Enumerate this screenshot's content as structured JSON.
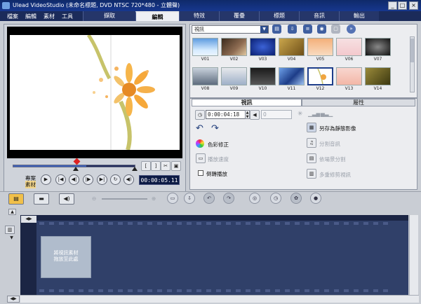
{
  "window": {
    "title": "Ulead VideoStudio (未命名標題, DVD NTSC 720*480 - 立體聲)",
    "buttons": [
      "_",
      "□",
      "×"
    ]
  },
  "menu": [
    "檔案",
    "編輯",
    "素材",
    "工具"
  ],
  "tabs": [
    {
      "label": "擷取",
      "active": false
    },
    {
      "label": "編輯",
      "active": true
    },
    {
      "label": "特效",
      "active": false
    },
    {
      "label": "覆疊",
      "active": false
    },
    {
      "label": "標題",
      "active": false
    },
    {
      "label": "音訊",
      "active": false
    },
    {
      "label": "輸出",
      "active": false
    }
  ],
  "preview": {
    "mode_labels": [
      "專案",
      "素材"
    ],
    "timecode": "00:00:05.11",
    "progress": 0.6
  },
  "library": {
    "category": "視訊",
    "thumbnails": [
      "V01",
      "V02",
      "V03",
      "V04",
      "V05",
      "V06",
      "V07",
      "V08",
      "V09",
      "V10",
      "V11",
      "V12",
      "V13",
      "V14"
    ]
  },
  "options": {
    "tabs": [
      "視訊",
      "屬性"
    ],
    "duration": "0:00:04:18",
    "volume": "0",
    "color_correct": "色彩修正",
    "speed": "播放速度",
    "reverse": "倒轉播放",
    "save_still": "另存為靜態影像",
    "split_audio": "分割音訊",
    "scene_split": "依場景分割",
    "multi_trim": "多重修剪視訊"
  },
  "storyboard": {
    "placeholder_line1": "將視訊素材",
    "placeholder_line2": "拖放至此處"
  },
  "colors": {
    "menubar": "#1b2b5a",
    "active_tab": "#eef0f4",
    "storyboard": "#1b2544",
    "filmstrip": "#304069"
  }
}
